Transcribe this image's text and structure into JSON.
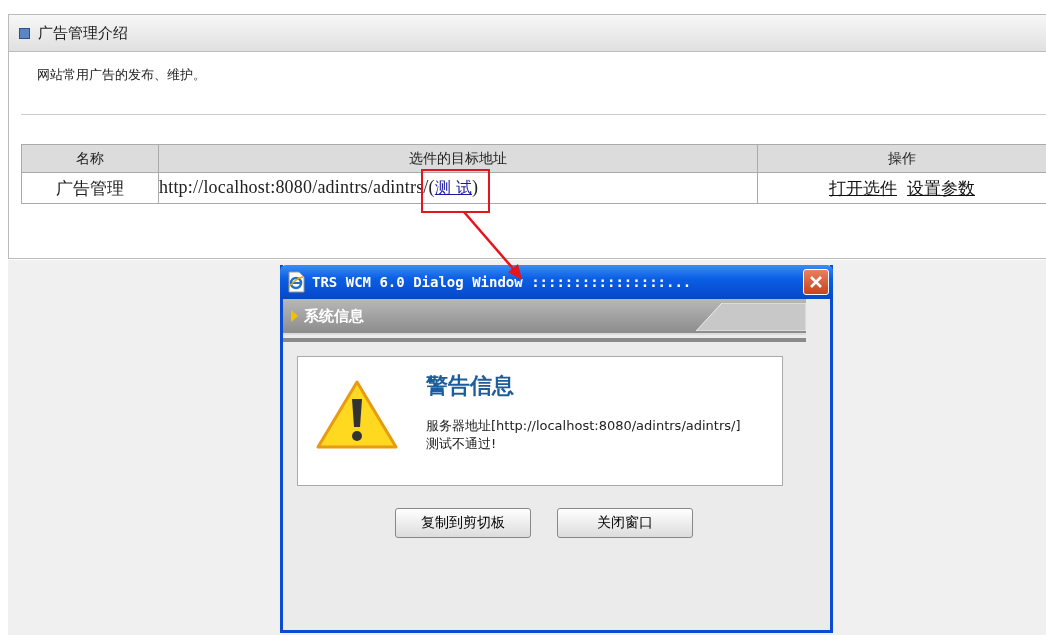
{
  "panel": {
    "title": "广告管理介绍",
    "description": "网站常用广告的发布、维护。"
  },
  "table": {
    "columns": [
      "名称",
      "选件的目标地址",
      "操作"
    ],
    "rows": [
      {
        "name": "广告管理",
        "url": "http://localhost:8080/adintrs/adintrs/",
        "test_open": "(",
        "test_link": "测 试",
        "test_close": ")",
        "actions": [
          "打开选件",
          "设置参数"
        ]
      }
    ]
  },
  "dialog": {
    "title": "TRS WCM 6.0 Dialog Window ::::::::::::::::...",
    "section": "系统信息",
    "heading": "警告信息",
    "message_lines": [
      "服务器地址[http://localhost:8080/adintrs/adintrs/]",
      "测试不通过!"
    ],
    "buttons": [
      "复制到剪切板",
      "关闭窗口"
    ]
  }
}
